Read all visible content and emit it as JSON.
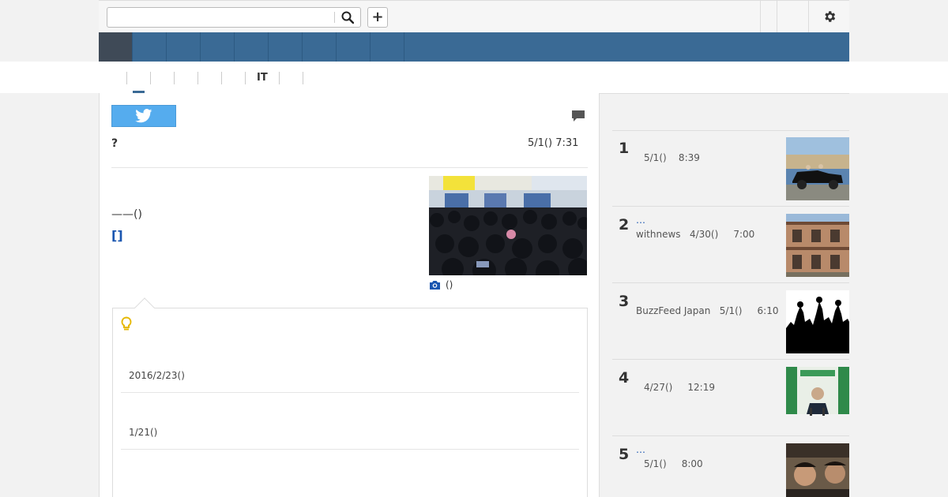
{
  "search": {
    "placeholder": "",
    "value": ""
  },
  "topbar": {
    "plus_label": "+"
  },
  "nav": {
    "items": [
      "",
      "",
      "",
      "",
      "",
      "",
      "",
      "",
      ""
    ]
  },
  "subnav": {
    "items": [
      "",
      "",
      "",
      "",
      "",
      "IT",
      "",
      ""
    ]
  },
  "article": {
    "title": "?",
    "date": "5/1() 7:31",
    "body_line1": "——()",
    "body_link": "[]",
    "photo_caption": "()"
  },
  "related": {
    "items": [
      {
        "date": "2016/2/23()"
      },
      {
        "date": "1/21()"
      }
    ]
  },
  "ranking": {
    "items": [
      {
        "rank": "1",
        "title": "",
        "meta": "5/1()    8:39"
      },
      {
        "rank": "2",
        "title": "…",
        "meta": "withnews   4/30()     7:00"
      },
      {
        "rank": "3",
        "title": "",
        "meta": "BuzzFeed Japan   5/1()     6:10"
      },
      {
        "rank": "4",
        "title": "",
        "meta": "4/27()     12:19"
      },
      {
        "rank": "5",
        "title": "…",
        "meta": "5/1()     8:00"
      }
    ]
  },
  "icons": {
    "search": "search-icon",
    "gear": "gear-icon",
    "twitter": "twitter-icon",
    "comment": "comment-icon",
    "camera": "camera-icon",
    "bulb": "lightbulb-icon"
  },
  "colors": {
    "nav_bg": "#3a6a95",
    "nav_active": "#3f4a57",
    "twitter": "#55acee",
    "link": "#1a56b0",
    "bulb": "#e6b800"
  }
}
